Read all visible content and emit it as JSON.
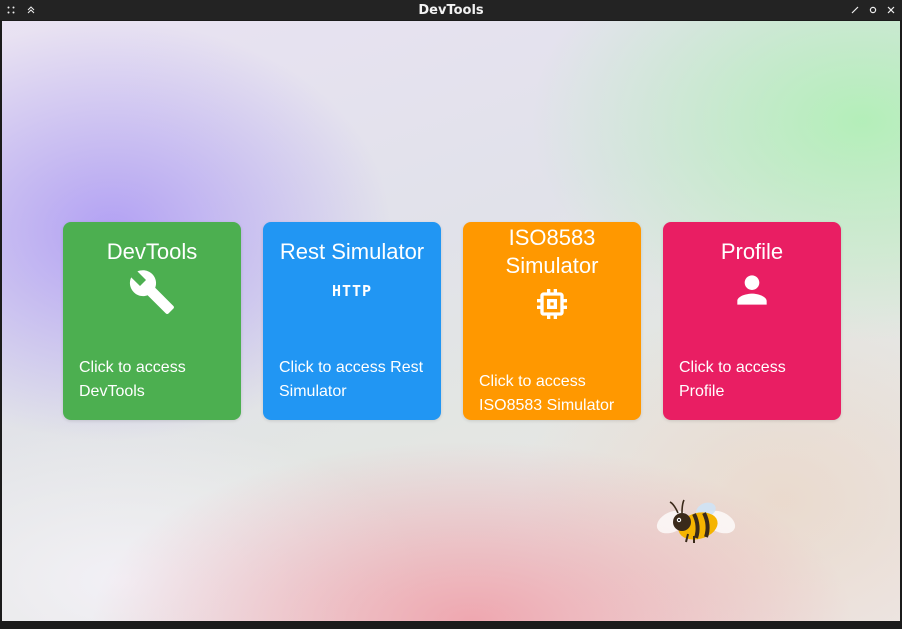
{
  "window": {
    "title": "DevTools"
  },
  "cards": [
    {
      "title": "DevTools",
      "description": "Click to access DevTools",
      "color": "#4caf50",
      "icon": "wrench-icon"
    },
    {
      "title": "Rest Simulator",
      "description": "Click to access Rest Simulator",
      "color": "#2196f3",
      "icon": "http-icon",
      "icon_text": "HTTP"
    },
    {
      "title": "ISO8583 Simulator",
      "description": "Click to access ISO8583 Simulator",
      "color": "#ff9800",
      "icon": "chip-icon"
    },
    {
      "title": "Profile",
      "description": "Click to access Profile",
      "color": "#e91e63",
      "icon": "person-icon"
    }
  ],
  "mascot": {
    "icon": "bee-icon"
  }
}
